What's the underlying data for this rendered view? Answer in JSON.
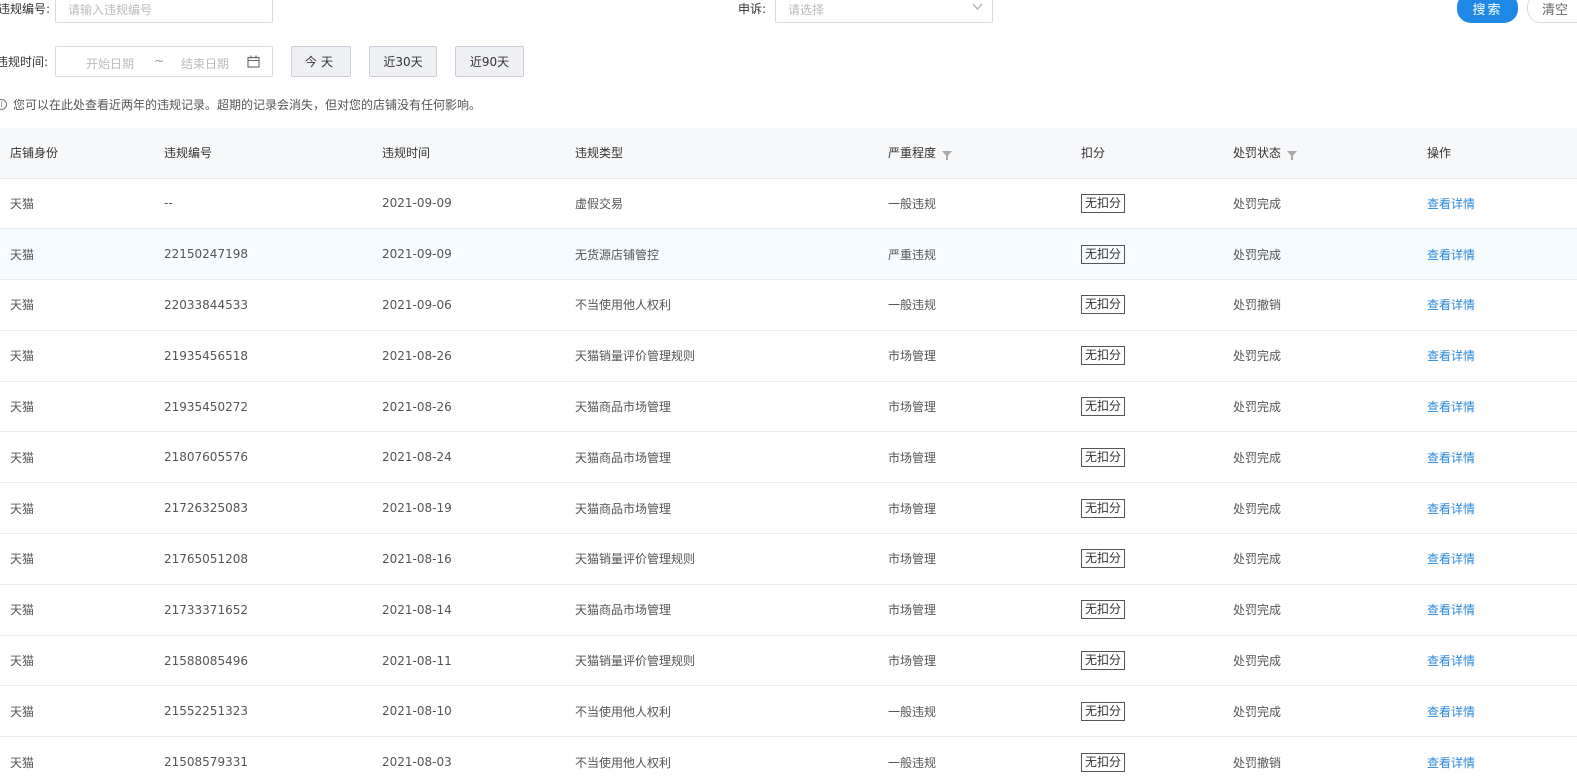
{
  "filters": {
    "violation_no_label": "违规编号:",
    "violation_no_placeholder": "请输入违规编号",
    "appeal_label": "申诉:",
    "appeal_placeholder": "请选择",
    "search_button": "搜索",
    "clear_button": "清空",
    "violation_time_label": "违规时间:",
    "start_date_placeholder": "开始日期",
    "date_separator": "~",
    "end_date_placeholder": "结束日期",
    "today_button": "今天",
    "last30_button": "近30天",
    "last90_button": "近90天"
  },
  "notice": "您可以在此处查看近两年的违规记录。超期的记录会消失，但对您的店铺没有任何影响。",
  "table": {
    "headers": [
      "店铺身份",
      "违规编号",
      "违规时间",
      "违规类型",
      "严重程度",
      "扣分",
      "处罚状态",
      "操作"
    ],
    "rows": [
      {
        "shop": "天猫",
        "no": "--",
        "time": "2021-09-09",
        "type": "虚假交易",
        "level": "一般违规",
        "points": "无扣分",
        "status": "处罚完成",
        "action": "查看详情"
      },
      {
        "shop": "天猫",
        "no": "22150247198",
        "time": "2021-09-09",
        "type": "无货源店铺管控",
        "level": "严重违规",
        "points": "无扣分",
        "status": "处罚完成",
        "action": "查看详情"
      },
      {
        "shop": "天猫",
        "no": "22033844533",
        "time": "2021-09-06",
        "type": "不当使用他人权利",
        "level": "一般违规",
        "points": "无扣分",
        "status": "处罚撤销",
        "action": "查看详情"
      },
      {
        "shop": "天猫",
        "no": "21935456518",
        "time": "2021-08-26",
        "type": "天猫销量评价管理规则",
        "level": "市场管理",
        "points": "无扣分",
        "status": "处罚完成",
        "action": "查看详情"
      },
      {
        "shop": "天猫",
        "no": "21935450272",
        "time": "2021-08-26",
        "type": "天猫商品市场管理",
        "level": "市场管理",
        "points": "无扣分",
        "status": "处罚完成",
        "action": "查看详情"
      },
      {
        "shop": "天猫",
        "no": "21807605576",
        "time": "2021-08-24",
        "type": "天猫商品市场管理",
        "level": "市场管理",
        "points": "无扣分",
        "status": "处罚完成",
        "action": "查看详情"
      },
      {
        "shop": "天猫",
        "no": "21726325083",
        "time": "2021-08-19",
        "type": "天猫商品市场管理",
        "level": "市场管理",
        "points": "无扣分",
        "status": "处罚完成",
        "action": "查看详情"
      },
      {
        "shop": "天猫",
        "no": "21765051208",
        "time": "2021-08-16",
        "type": "天猫销量评价管理规则",
        "level": "市场管理",
        "points": "无扣分",
        "status": "处罚完成",
        "action": "查看详情"
      },
      {
        "shop": "天猫",
        "no": "21733371652",
        "time": "2021-08-14",
        "type": "天猫商品市场管理",
        "level": "市场管理",
        "points": "无扣分",
        "status": "处罚完成",
        "action": "查看详情"
      },
      {
        "shop": "天猫",
        "no": "21588085496",
        "time": "2021-08-11",
        "type": "天猫销量评价管理规则",
        "level": "市场管理",
        "points": "无扣分",
        "status": "处罚完成",
        "action": "查看详情"
      },
      {
        "shop": "天猫",
        "no": "21552251323",
        "time": "2021-08-10",
        "type": "不当使用他人权利",
        "level": "一般违规",
        "points": "无扣分",
        "status": "处罚完成",
        "action": "查看详情"
      },
      {
        "shop": "天猫",
        "no": "21508579331",
        "time": "2021-08-03",
        "type": "不当使用他人权利",
        "level": "一般违规",
        "points": "无扣分",
        "status": "处罚撤销",
        "action": "查看详情"
      }
    ]
  },
  "colors": {
    "primary": "#1e88e5",
    "link": "#2b88d8",
    "header_bg": "#f7f8fa",
    "highlight_row_bg": "#f5fbfe"
  },
  "icons": [
    "calendar-icon",
    "chevron-down-icon",
    "info-icon",
    "filter-icon"
  ]
}
